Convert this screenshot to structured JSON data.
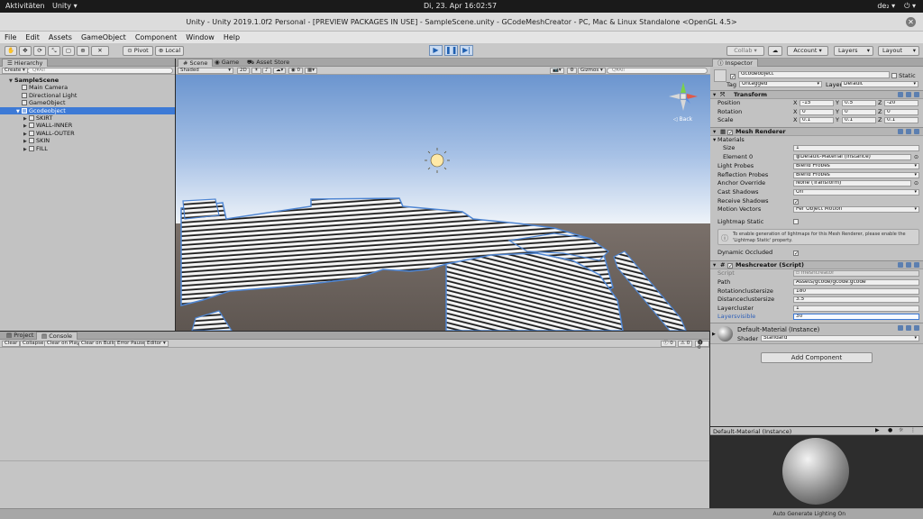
{
  "gnome": {
    "activities": "Aktivitäten",
    "app": "Unity ▾",
    "clock": "Di, 23. Apr  16:02:57",
    "tray": [
      "de₂ ▾",
      "⏻ ▾"
    ]
  },
  "window": {
    "title": "Unity - Unity 2019.1.0f2 Personal - [PREVIEW PACKAGES IN USE] - SampleScene.unity - GCodeMeshCreator - PC, Mac & Linux Standalone <OpenGL 4.5>"
  },
  "menu": [
    "File",
    "Edit",
    "Assets",
    "GameObject",
    "Component",
    "Window",
    "Help"
  ],
  "toolbar": {
    "pivot": "Pivot",
    "local": "Local",
    "collab": "Collab ▾",
    "account": "Account ▾",
    "layers": "Layers",
    "layout": "Layout"
  },
  "hierarchy": {
    "tab": "Hierarchy",
    "create": "Create ▾",
    "search_placeholder": "Q▾All",
    "items": [
      {
        "label": "SampleScene",
        "depth": 0,
        "expanded": true,
        "selected": false,
        "bold": true
      },
      {
        "label": "Main Camera",
        "depth": 1,
        "selected": false
      },
      {
        "label": "Directional Light",
        "depth": 1,
        "selected": false
      },
      {
        "label": "GameObject",
        "depth": 1,
        "selected": false
      },
      {
        "label": "Gcodeobject",
        "depth": 1,
        "expanded": true,
        "selected": true
      },
      {
        "label": "SKIRT",
        "depth": 2,
        "selected": false
      },
      {
        "label": "WALL-INNER",
        "depth": 2,
        "selected": false
      },
      {
        "label": "WALL-OUTER",
        "depth": 2,
        "selected": false
      },
      {
        "label": "SKIN",
        "depth": 2,
        "selected": false
      },
      {
        "label": "FILL",
        "depth": 2,
        "selected": false
      }
    ]
  },
  "scene": {
    "tabs": [
      "Scene",
      "Game",
      "Asset Store"
    ],
    "shading": "Shaded",
    "mode2d": "2D",
    "gizmos": "Gizmos ▾",
    "search_placeholder": "Q▾All",
    "gizmo_back": "◁ Back"
  },
  "bottom": {
    "tabs": [
      "Project",
      "Console"
    ],
    "buttons": [
      "Clear",
      "Collapse",
      "Clear on Play",
      "Clear on Build",
      "Error Pause",
      "Editor ▾"
    ],
    "counts": [
      "0",
      "0",
      "0"
    ]
  },
  "inspector": {
    "tab": "Inspector",
    "object_name": "Gcodeobject",
    "static_label": "Static",
    "tag_label": "Tag",
    "tag_value": "Untagged",
    "layer_label": "Layer",
    "layer_value": "Default",
    "transform": {
      "title": "Transform",
      "rows": [
        {
          "label": "Position",
          "x": "-15",
          "y": "0.5",
          "z": "-20"
        },
        {
          "label": "Rotation",
          "x": "0",
          "y": "0",
          "z": "0"
        },
        {
          "label": "Scale",
          "x": "0.1",
          "y": "0.1",
          "z": "0.1"
        }
      ]
    },
    "mesh_renderer": {
      "title": "Mesh Renderer",
      "materials_label": "Materials",
      "size_label": "Size",
      "size_value": "1",
      "element0_label": "Element 0",
      "element0_value": "Default-Material (Instance)",
      "props": [
        {
          "label": "Light Probes",
          "value": "Blend Probes"
        },
        {
          "label": "Reflection Probes",
          "value": "Blend Probes"
        },
        {
          "label": "Anchor Override",
          "value": "None (Transform)"
        },
        {
          "label": "Cast Shadows",
          "value": "On"
        }
      ],
      "receive_shadows": "Receive Shadows",
      "motion_vectors_label": "Motion Vectors",
      "motion_vectors_value": "Per Object Motion",
      "lightmap_static": "Lightmap Static",
      "info_text": "To enable generation of lightmaps for this Mesh Renderer, please enable the 'Lightmap Static' property.",
      "dynamic_occluded": "Dynamic Occluded"
    },
    "meshcreator": {
      "title": "Meshcreator (Script)",
      "script_label": "Script",
      "script_value": "meshcreator",
      "fields": [
        {
          "label": "Path",
          "value": "Assets/gcode/gcode.gcode"
        },
        {
          "label": "Rotationclustersize",
          "value": "180"
        },
        {
          "label": "Distanceclustersize",
          "value": "3.5"
        },
        {
          "label": "Layercluster",
          "value": "1"
        },
        {
          "label": "Layersvisible",
          "value": "30",
          "active": true
        }
      ]
    },
    "material": {
      "name": "Default-Material (Instance)",
      "shader_label": "Shader",
      "shader_value": "Standard"
    },
    "add_component": "Add Component",
    "preview_title": "Default-Material (Instance)"
  },
  "status": {
    "right": "Auto Generate Lighting On"
  },
  "colors": {
    "selection": "#3d7ad6",
    "sky_top": "#6b95cf",
    "sky_horizon": "#eef3f9",
    "ground": "#6e6560",
    "mesh_outline": "#4f86d3"
  }
}
